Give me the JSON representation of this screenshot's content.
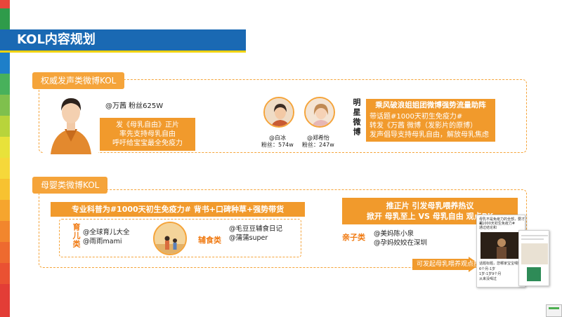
{
  "title": "KOL内容规划",
  "colors": {
    "accent": "#f5a43a",
    "title_blue": "#1a69b3",
    "orange_fill": "#f19a2c"
  },
  "section1": {
    "tab": "权威发声类微博KOL",
    "main_kol": "@万茜 粉丝625W",
    "main_box": [
      "发《母乳自由》正片",
      "率先支持母乳自由",
      "呼吁给宝宝最全免疫力"
    ],
    "kol_a": {
      "name": "@白冰",
      "fans": "粉丝：574w"
    },
    "kol_b": {
      "name": "@郑希怡",
      "fans": "粉丝：247w"
    },
    "side_label": "明星微博",
    "headline": "乘风破浪姐姐团微博强势流量助阵",
    "right_lines": [
      "带话题#1000天初生免疫力#",
      "转发《万茜 微博（发影片的原博）",
      "发声倡导支持母乳自由，解放母乳焦虑"
    ]
  },
  "section2": {
    "tab": "母婴类微博KOL",
    "banner_left": "专业科普为#1000天初生免疫力# 背书+口碑种草+强势带货",
    "banner_right": [
      "推正片 引发母乳喂养热议",
      "掀开 母乳至上 VS 母乳自由  观点PK"
    ],
    "cat_a": "育儿类",
    "cat_a_accounts": [
      "@全球育儿大全",
      "@雨雨mami"
    ],
    "cat_b": "辅食类",
    "cat_b_accounts": [
      "@毛豆豆辅食日记",
      "@蒲蒲super"
    ],
    "cat_c": "亲子类",
    "cat_c_accounts": [
      "@美妈陈小泉",
      "@孕妈姣姣在深圳"
    ],
    "arrow_text": "可发起母乳喂养观点投票",
    "phone_text": [
      "母乳不是免疫力的全部，要才是",
      "#1000天初生免疫力#",
      "通过结论和",
      "话题标题，您哪家宝宝喂奶",
      "6个月-1岁",
      "1岁-1岁9个月",
      "从来没喝过"
    ]
  }
}
